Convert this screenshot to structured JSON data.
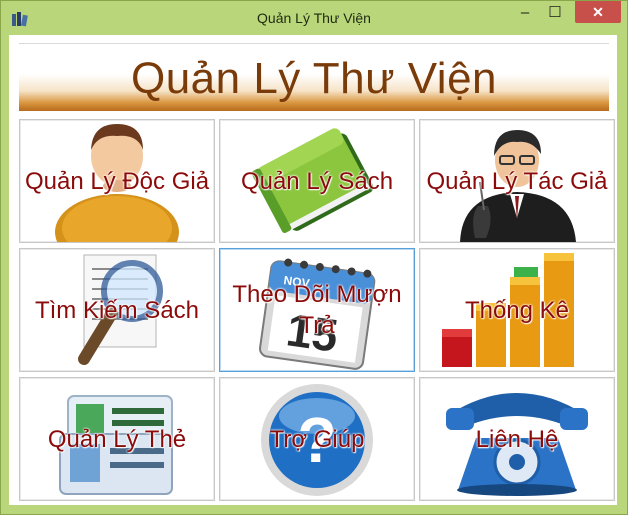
{
  "window": {
    "title": "Quản Lý Thư Viện",
    "minimize": "–",
    "maximize": "☐",
    "close": "✕"
  },
  "banner": {
    "title": "Quản Lý Thư Viện"
  },
  "tiles": [
    {
      "label": "Quản Lý Độc Giả",
      "icon": "reader-person-icon"
    },
    {
      "label": "Quản Lý Sách",
      "icon": "green-book-icon"
    },
    {
      "label": "Quản Lý Tác Giả",
      "icon": "author-businessman-icon"
    },
    {
      "label": "Tìm Kiếm Sách",
      "icon": "magnifier-document-icon"
    },
    {
      "label": "Theo Dõi Mượn Trả",
      "icon": "calendar-icon"
    },
    {
      "label": "Thống Kê",
      "icon": "bar-chart-icon"
    },
    {
      "label": "Quản Lý Thẻ",
      "icon": "id-card-icon"
    },
    {
      "label": "Trợ Giúp",
      "icon": "help-question-icon"
    },
    {
      "label": "Liên Hệ",
      "icon": "telephone-icon"
    }
  ],
  "calendar": {
    "month": "NOV",
    "day": "15"
  },
  "colors": {
    "title_bar": "#b9d77a",
    "label": "#8b0b0b",
    "banner_text": "#7a3b0a",
    "close": "#c7504b"
  }
}
